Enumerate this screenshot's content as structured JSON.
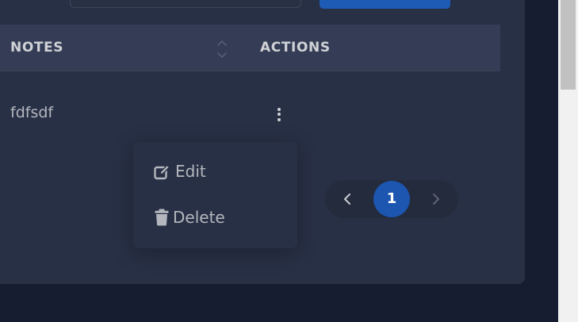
{
  "table": {
    "headers": [
      "NOTES",
      "ACTIONS"
    ],
    "rows": [
      {
        "notes": "fdfsdf"
      }
    ]
  },
  "row_actions_menu": {
    "items": [
      {
        "label": "Edit",
        "icon": "edit-icon"
      },
      {
        "label": "Delete",
        "icon": "trash-icon"
      }
    ]
  },
  "pagination": {
    "current_page": "1",
    "prev_icon": "chevron-left-icon",
    "next_icon": "chevron-right-icon"
  },
  "colors": {
    "page_background": "#161d31",
    "card_background": "#283046",
    "header_background": "#343d55",
    "primary": "#1c56b0",
    "text": "#b4b7bd"
  }
}
